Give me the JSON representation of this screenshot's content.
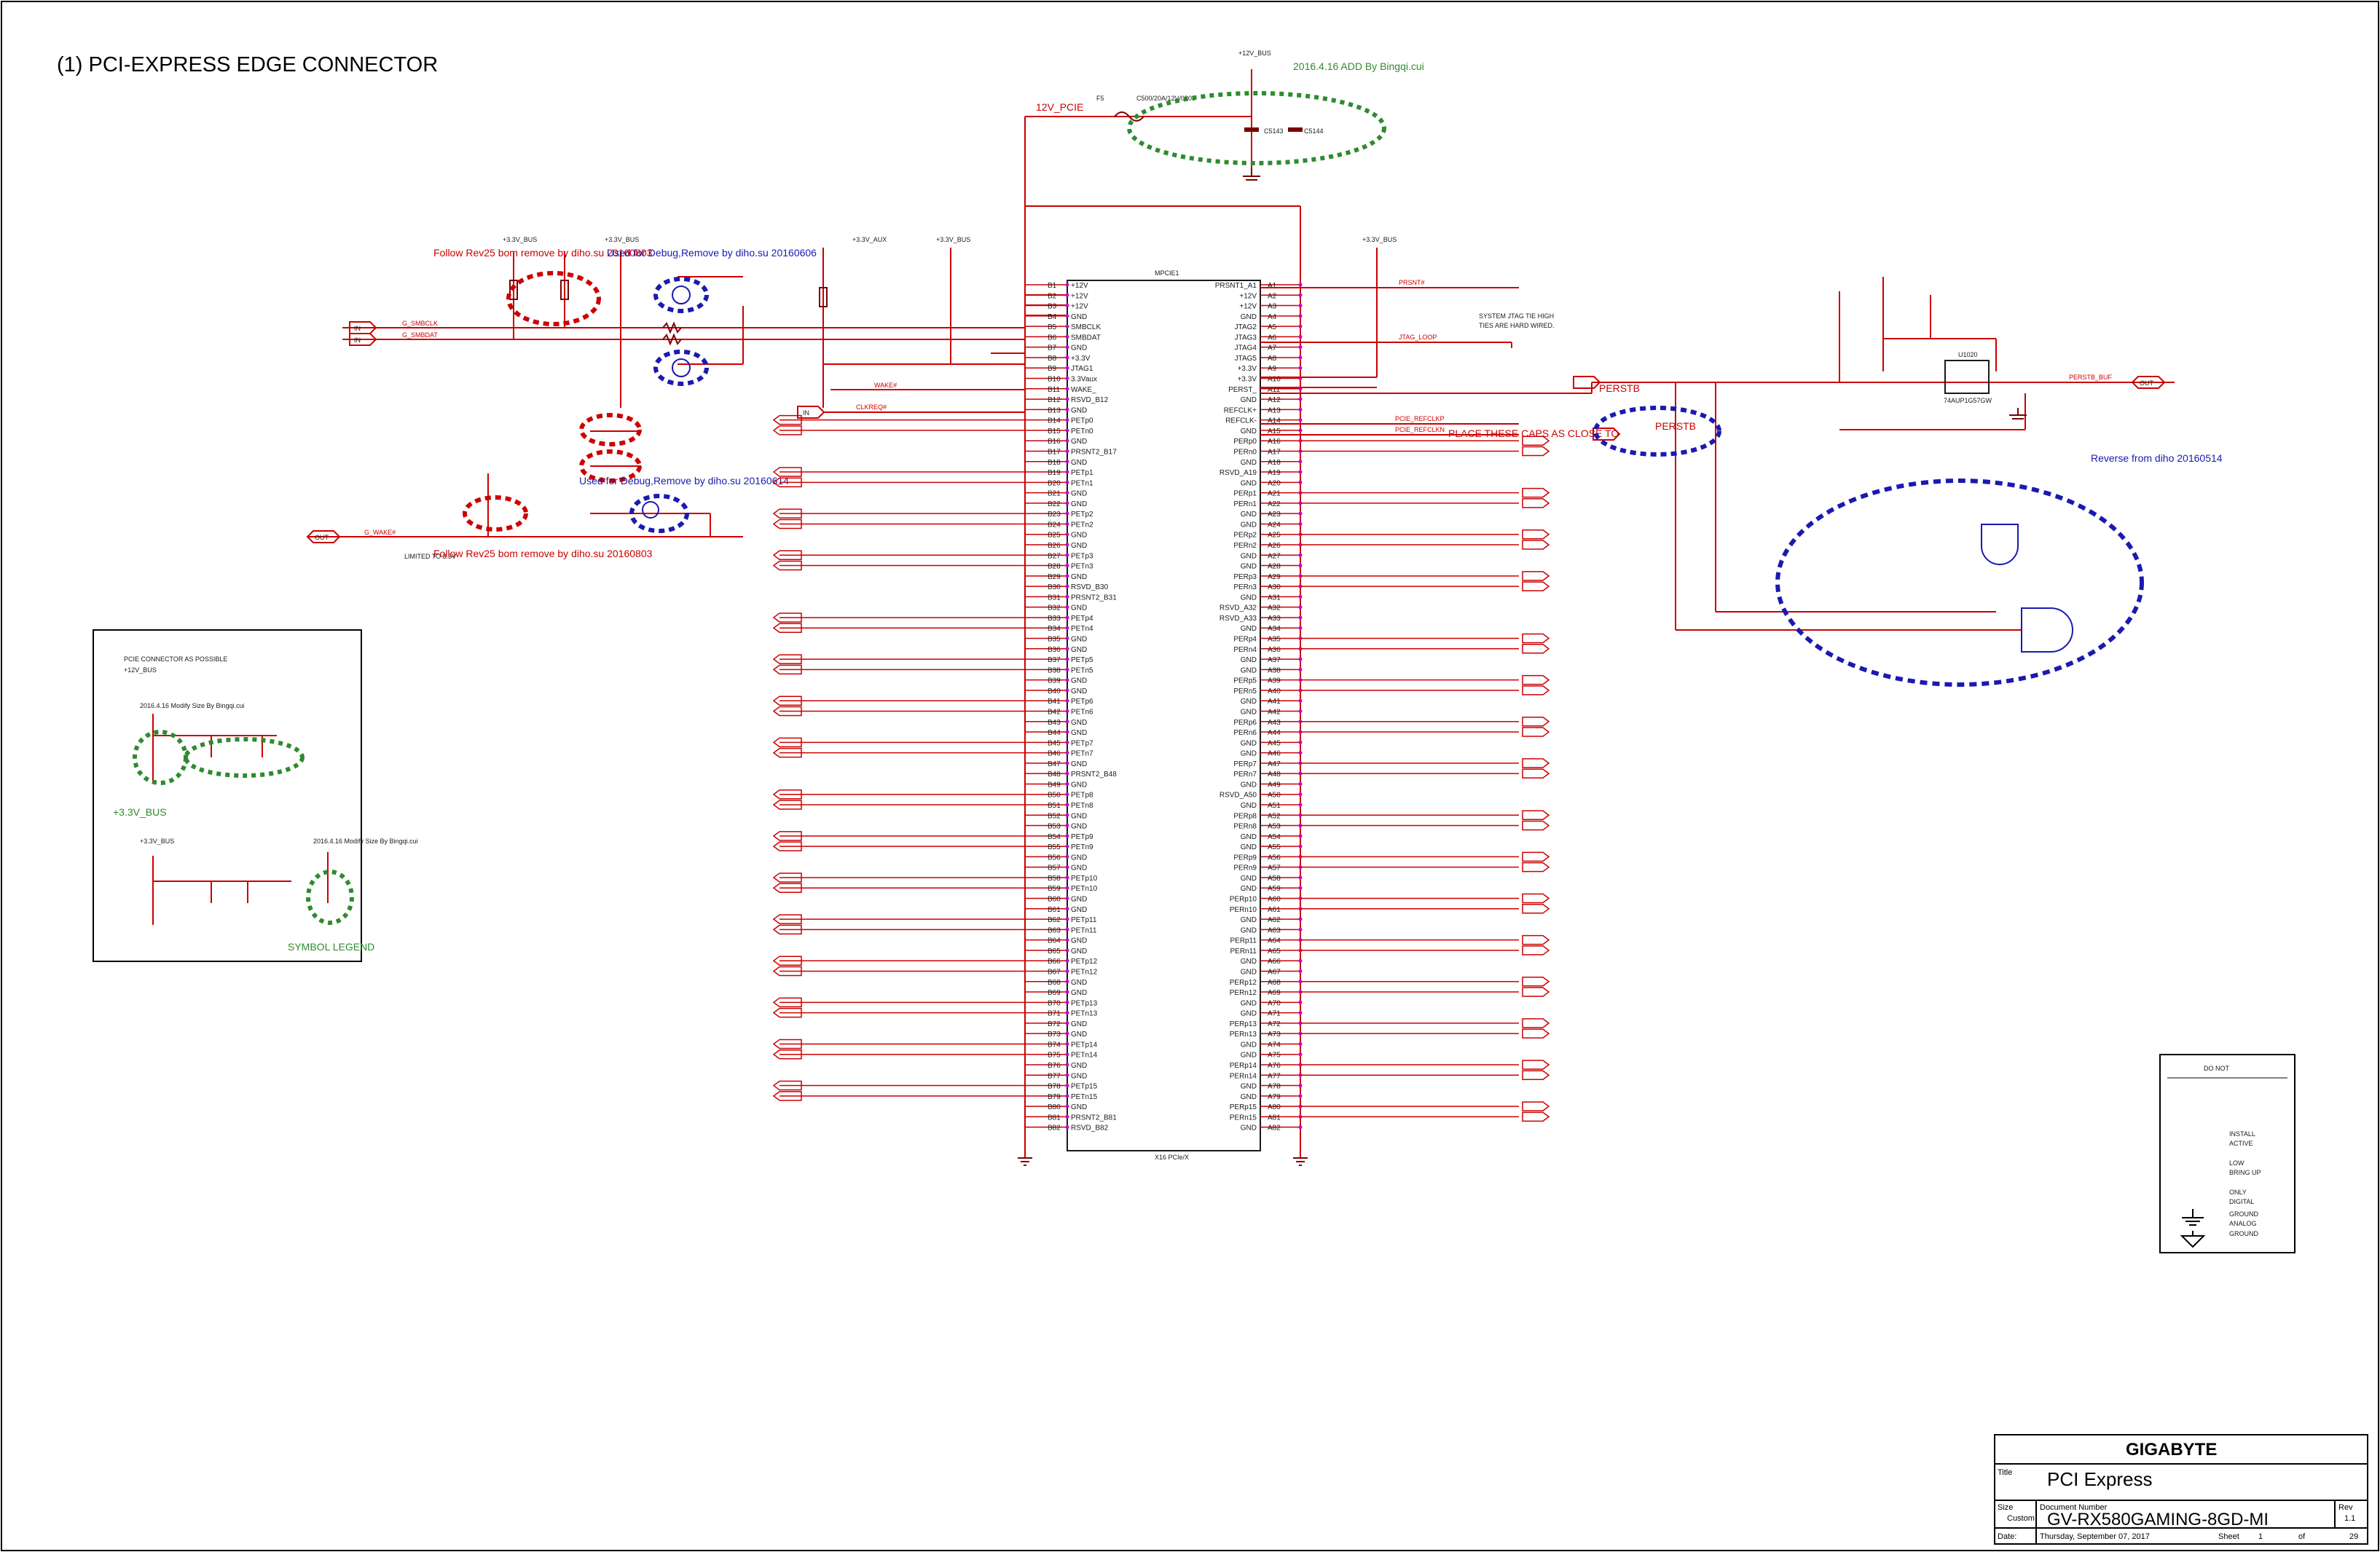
{
  "page": {
    "title": "(1) PCI-EXPRESS EDGE CONNECTOR"
  },
  "connector": {
    "ref": "MPCIE1",
    "bottom_label": "X16 PCIe/X",
    "left_pins": [
      {
        "num": "B1",
        "name": "+12V"
      },
      {
        "num": "B2",
        "name": "+12V"
      },
      {
        "num": "B3",
        "name": "+12V"
      },
      {
        "num": "B4",
        "name": "GND"
      },
      {
        "num": "B5",
        "name": "SMBCLK"
      },
      {
        "num": "B6",
        "name": "SMBDAT"
      },
      {
        "num": "B7",
        "name": "GND"
      },
      {
        "num": "B8",
        "name": "+3.3V"
      },
      {
        "num": "B9",
        "name": "JTAG1"
      },
      {
        "num": "B10",
        "name": "3.3Vaux"
      },
      {
        "num": "B11",
        "name": "WAKE_"
      },
      {
        "num": "B12",
        "name": "RSVD_B12"
      },
      {
        "num": "B13",
        "name": "GND"
      },
      {
        "num": "B14",
        "name": "PETp0"
      },
      {
        "num": "B15",
        "name": "PETn0"
      },
      {
        "num": "B16",
        "name": "GND"
      },
      {
        "num": "B17",
        "name": "PRSNT2_B17"
      },
      {
        "num": "B18",
        "name": "GND"
      },
      {
        "num": "B19",
        "name": "PETp1"
      },
      {
        "num": "B20",
        "name": "PETn1"
      },
      {
        "num": "B21",
        "name": "GND"
      },
      {
        "num": "B22",
        "name": "GND"
      },
      {
        "num": "B23",
        "name": "PETp2"
      },
      {
        "num": "B24",
        "name": "PETn2"
      },
      {
        "num": "B25",
        "name": "GND"
      },
      {
        "num": "B26",
        "name": "GND"
      },
      {
        "num": "B27",
        "name": "PETp3"
      },
      {
        "num": "B28",
        "name": "PETn3"
      },
      {
        "num": "B29",
        "name": "GND"
      },
      {
        "num": "B30",
        "name": "RSVD_B30"
      },
      {
        "num": "B31",
        "name": "PRSNT2_B31"
      },
      {
        "num": "B32",
        "name": "GND"
      },
      {
        "num": "B33",
        "name": "PETp4"
      },
      {
        "num": "B34",
        "name": "PETn4"
      },
      {
        "num": "B35",
        "name": "GND"
      },
      {
        "num": "B36",
        "name": "GND"
      },
      {
        "num": "B37",
        "name": "PETp5"
      },
      {
        "num": "B38",
        "name": "PETn5"
      },
      {
        "num": "B39",
        "name": "GND"
      },
      {
        "num": "B40",
        "name": "GND"
      },
      {
        "num": "B41",
        "name": "PETp6"
      },
      {
        "num": "B42",
        "name": "PETn6"
      },
      {
        "num": "B43",
        "name": "GND"
      },
      {
        "num": "B44",
        "name": "GND"
      },
      {
        "num": "B45",
        "name": "PETp7"
      },
      {
        "num": "B46",
        "name": "PETn7"
      },
      {
        "num": "B47",
        "name": "GND"
      },
      {
        "num": "B48",
        "name": "PRSNT2_B48"
      },
      {
        "num": "B49",
        "name": "GND"
      },
      {
        "num": "B50",
        "name": "PETp8"
      },
      {
        "num": "B51",
        "name": "PETn8"
      },
      {
        "num": "B52",
        "name": "GND"
      },
      {
        "num": "B53",
        "name": "GND"
      },
      {
        "num": "B54",
        "name": "PETp9"
      },
      {
        "num": "B55",
        "name": "PETn9"
      },
      {
        "num": "B56",
        "name": "GND"
      },
      {
        "num": "B57",
        "name": "GND"
      },
      {
        "num": "B58",
        "name": "PETp10"
      },
      {
        "num": "B59",
        "name": "PETn10"
      },
      {
        "num": "B60",
        "name": "GND"
      },
      {
        "num": "B61",
        "name": "GND"
      },
      {
        "num": "B62",
        "name": "PETp11"
      },
      {
        "num": "B63",
        "name": "PETn11"
      },
      {
        "num": "B64",
        "name": "GND"
      },
      {
        "num": "B65",
        "name": "GND"
      },
      {
        "num": "B66",
        "name": "PETp12"
      },
      {
        "num": "B67",
        "name": "PETn12"
      },
      {
        "num": "B68",
        "name": "GND"
      },
      {
        "num": "B69",
        "name": "GND"
      },
      {
        "num": "B70",
        "name": "PETp13"
      },
      {
        "num": "B71",
        "name": "PETn13"
      },
      {
        "num": "B72",
        "name": "GND"
      },
      {
        "num": "B73",
        "name": "GND"
      },
      {
        "num": "B74",
        "name": "PETp14"
      },
      {
        "num": "B75",
        "name": "PETn14"
      },
      {
        "num": "B76",
        "name": "GND"
      },
      {
        "num": "B77",
        "name": "GND"
      },
      {
        "num": "B78",
        "name": "PETp15"
      },
      {
        "num": "B79",
        "name": "PETn15"
      },
      {
        "num": "B80",
        "name": "GND"
      },
      {
        "num": "B81",
        "name": "PRSNT2_B81"
      },
      {
        "num": "B82",
        "name": "RSVD_B82"
      }
    ],
    "right_pins": [
      {
        "num": "A1",
        "name": "PRSNT1_A1"
      },
      {
        "num": "A2",
        "name": "+12V"
      },
      {
        "num": "A3",
        "name": "+12V"
      },
      {
        "num": "A4",
        "name": "GND"
      },
      {
        "num": "A5",
        "name": "JTAG2"
      },
      {
        "num": "A6",
        "name": "JTAG3"
      },
      {
        "num": "A7",
        "name": "JTAG4"
      },
      {
        "num": "A8",
        "name": "JTAG5"
      },
      {
        "num": "A9",
        "name": "+3.3V"
      },
      {
        "num": "A10",
        "name": "+3.3V"
      },
      {
        "num": "A11",
        "name": "PERST_"
      },
      {
        "num": "A12",
        "name": "GND"
      },
      {
        "num": "A13",
        "name": "REFCLK+"
      },
      {
        "num": "A14",
        "name": "REFCLK-"
      },
      {
        "num": "A15",
        "name": "GND"
      },
      {
        "num": "A16",
        "name": "PERp0"
      },
      {
        "num": "A17",
        "name": "PERn0"
      },
      {
        "num": "A18",
        "name": "GND"
      },
      {
        "num": "A19",
        "name": "RSVD_A19"
      },
      {
        "num": "A20",
        "name": "GND"
      },
      {
        "num": "A21",
        "name": "PERp1"
      },
      {
        "num": "A22",
        "name": "PERn1"
      },
      {
        "num": "A23",
        "name": "GND"
      },
      {
        "num": "A24",
        "name": "GND"
      },
      {
        "num": "A25",
        "name": "PERp2"
      },
      {
        "num": "A26",
        "name": "PERn2"
      },
      {
        "num": "A27",
        "name": "GND"
      },
      {
        "num": "A28",
        "name": "GND"
      },
      {
        "num": "A29",
        "name": "PERp3"
      },
      {
        "num": "A30",
        "name": "PERn3"
      },
      {
        "num": "A31",
        "name": "GND"
      },
      {
        "num": "A32",
        "name": "RSVD_A32"
      },
      {
        "num": "A33",
        "name": "RSVD_A33"
      },
      {
        "num": "A34",
        "name": "GND"
      },
      {
        "num": "A35",
        "name": "PERp4"
      },
      {
        "num": "A36",
        "name": "PERn4"
      },
      {
        "num": "A37",
        "name": "GND"
      },
      {
        "num": "A38",
        "name": "GND"
      },
      {
        "num": "A39",
        "name": "PERp5"
      },
      {
        "num": "A40",
        "name": "PERn5"
      },
      {
        "num": "A41",
        "name": "GND"
      },
      {
        "num": "A42",
        "name": "GND"
      },
      {
        "num": "A43",
        "name": "PERp6"
      },
      {
        "num": "A44",
        "name": "PERn6"
      },
      {
        "num": "A45",
        "name": "GND"
      },
      {
        "num": "A46",
        "name": "GND"
      },
      {
        "num": "A47",
        "name": "PERp7"
      },
      {
        "num": "A48",
        "name": "PERn7"
      },
      {
        "num": "A49",
        "name": "GND"
      },
      {
        "num": "A50",
        "name": "RSVD_A50"
      },
      {
        "num": "A51",
        "name": "GND"
      },
      {
        "num": "A52",
        "name": "PERp8"
      },
      {
        "num": "A53",
        "name": "PERn8"
      },
      {
        "num": "A54",
        "name": "GND"
      },
      {
        "num": "A55",
        "name": "GND"
      },
      {
        "num": "A56",
        "name": "PERp9"
      },
      {
        "num": "A57",
        "name": "PERn9"
      },
      {
        "num": "A58",
        "name": "GND"
      },
      {
        "num": "A59",
        "name": "GND"
      },
      {
        "num": "A60",
        "name": "PERp10"
      },
      {
        "num": "A61",
        "name": "PERn10"
      },
      {
        "num": "A62",
        "name": "GND"
      },
      {
        "num": "A63",
        "name": "GND"
      },
      {
        "num": "A64",
        "name": "PERp11"
      },
      {
        "num": "A65",
        "name": "PERn11"
      },
      {
        "num": "A66",
        "name": "GND"
      },
      {
        "num": "A67",
        "name": "GND"
      },
      {
        "num": "A68",
        "name": "PERp12"
      },
      {
        "num": "A69",
        "name": "PERn12"
      },
      {
        "num": "A70",
        "name": "GND"
      },
      {
        "num": "A71",
        "name": "GND"
      },
      {
        "num": "A72",
        "name": "PERp13"
      },
      {
        "num": "A73",
        "name": "PERn13"
      },
      {
        "num": "A74",
        "name": "GND"
      },
      {
        "num": "A75",
        "name": "GND"
      },
      {
        "num": "A76",
        "name": "PERp14"
      },
      {
        "num": "A77",
        "name": "PERn14"
      },
      {
        "num": "A78",
        "name": "GND"
      },
      {
        "num": "A79",
        "name": "GND"
      },
      {
        "num": "A80",
        "name": "PERp15"
      },
      {
        "num": "A81",
        "name": "PERn15"
      },
      {
        "num": "A82",
        "name": "GND"
      }
    ]
  },
  "texts": [
    {
      "id": "rail-12v-top",
      "text": "+12V_BUS",
      "cls": "tiny"
    },
    {
      "id": "note-add-bingqi",
      "text": "2016.4.16 ADD By Bingqi.cui",
      "cls": "green note"
    },
    {
      "id": "net-12v-pcie",
      "text": "12V_PCIE",
      "cls": "red note"
    },
    {
      "id": "fuse-ref",
      "text": "F5",
      "cls": "tiny"
    },
    {
      "id": "fuse-val",
      "text": "C500/20A/12V/0805",
      "cls": "tiny"
    },
    {
      "id": "cap-c5143",
      "text": "C5143",
      "cls": "tiny"
    },
    {
      "id": "cap-c5144",
      "text": "C5144",
      "cls": "tiny"
    },
    {
      "id": "note-follow-1",
      "text": "Follow Rev25 bom remove by diho.su 20160803",
      "cls": "red note"
    },
    {
      "id": "note-debug-1",
      "text": "Used for Debug,Remove by diho.su 20160606",
      "cls": "blue note"
    },
    {
      "id": "net-smbclk",
      "text": "G_SMBCLK",
      "cls": "red tiny"
    },
    {
      "id": "net-smbdat",
      "text": "G_SMBDAT",
      "cls": "red tiny"
    },
    {
      "id": "port-in-1",
      "text": "IN",
      "cls": "tiny"
    },
    {
      "id": "port-in-2",
      "text": "IN",
      "cls": "tiny"
    },
    {
      "id": "port-in-cls",
      "text": "IN",
      "cls": "tiny"
    },
    {
      "id": "net-clkreq",
      "text": "CLKREQ#",
      "cls": "red tiny"
    },
    {
      "id": "note-debug-2",
      "text": "Used for Debug,Remove by diho.su 20160614",
      "cls": "blue note"
    },
    {
      "id": "note-follow-2",
      "text": "Follow Rev25 bom remove by diho.su 20160803",
      "cls": "red note"
    },
    {
      "id": "net-gwake",
      "text": "G_WAKE#",
      "cls": "red tiny"
    },
    {
      "id": "port-out-wake",
      "text": "OUT",
      "cls": "tiny"
    },
    {
      "id": "note-limited",
      "text": "LIMITED TO 3.3V",
      "cls": "tiny"
    },
    {
      "id": "rail-33v-aux",
      "text": "+3.3V_AUX",
      "cls": "tiny"
    },
    {
      "id": "rail-33v-bus-1",
      "text": "+3.3V_BUS",
      "cls": "tiny"
    },
    {
      "id": "rail-33v-bus-2",
      "text": "+3.3V_BUS",
      "cls": "tiny"
    },
    {
      "id": "rail-33v-bus-3",
      "text": "+3.3V_BUS",
      "cls": "tiny"
    },
    {
      "id": "rail-33v-bus-4",
      "text": "+3.3V_BUS",
      "cls": "tiny"
    },
    {
      "id": "net-wakeb",
      "text": "WAKE#",
      "cls": "red tiny"
    },
    {
      "id": "net-prsnt",
      "text": "PRSNT#",
      "cls": "red tiny"
    },
    {
      "id": "net-jtag",
      "text": "JTAG_LOOP",
      "cls": "red tiny"
    },
    {
      "id": "note-system-jtag",
      "text": "SYSTEM JTAG TIE HIGH",
      "cls": "tiny"
    },
    {
      "id": "note-ties",
      "text": "TIES ARE HARD WIRED.",
      "cls": "tiny"
    },
    {
      "id": "net-refclkp",
      "text": "PCIE_REFCLKP",
      "cls": "red tiny"
    },
    {
      "id": "net-refclkn",
      "text": "PCIE_REFCLKN",
      "cls": "red tiny"
    },
    {
      "id": "net-perstb",
      "text": "PERSTB",
      "cls": "red note"
    },
    {
      "id": "net-perstb2",
      "text": "PERSTB",
      "cls": "red note"
    },
    {
      "id": "note-reverse",
      "text": "Reverse from diho 20160514",
      "cls": "blue note"
    },
    {
      "id": "ic-u1020",
      "text": "U1020",
      "cls": "tiny"
    },
    {
      "id": "ic-logic",
      "text": "74AUP1G57GW",
      "cls": "tiny"
    },
    {
      "id": "net-perstb-buf",
      "text": "PERSTB_BUF",
      "cls": "red tiny"
    },
    {
      "id": "port-out-perst",
      "text": "OUT",
      "cls": "tiny"
    },
    {
      "id": "net-num-29",
      "text": "29",
      "cls": "red note"
    },
    {
      "id": "box-note-1",
      "text": "PLACE THESE CAPS AS CLOSE TO",
      "cls": "tiny"
    },
    {
      "id": "box-note-2",
      "text": "PCIE CONNECTOR AS POSSIBLE",
      "cls": "tiny"
    },
    {
      "id": "box-12v",
      "text": "+12V_BUS",
      "cls": "tiny"
    },
    {
      "id": "note-modify-1",
      "text": "2016.4.16 Modify Size By Bingqi.cui",
      "cls": "green note"
    },
    {
      "id": "box-33v",
      "text": "+3.3V_BUS",
      "cls": "tiny"
    },
    {
      "id": "box-33v-2",
      "text": "+3.3V_BUS",
      "cls": "tiny"
    },
    {
      "id": "note-modify-2",
      "text": "2016.4.16 Modify Size By Bingqi.cui",
      "cls": "green note"
    },
    {
      "id": "legend-title",
      "text": "SYMBOL LEGEND",
      "cls": "tiny"
    },
    {
      "id": "legend-1a",
      "text": "DO NOT",
      "cls": "tiny"
    },
    {
      "id": "legend-1b",
      "text": "INSTALL",
      "cls": "tiny"
    },
    {
      "id": "legend-2a",
      "text": "ACTIVE",
      "cls": "tiny"
    },
    {
      "id": "legend-2b",
      "text": "LOW",
      "cls": "tiny"
    },
    {
      "id": "legend-3a",
      "text": "BRING UP",
      "cls": "tiny"
    },
    {
      "id": "legend-3b",
      "text": "ONLY",
      "cls": "tiny"
    },
    {
      "id": "legend-4a",
      "text": "DIGITAL",
      "cls": "tiny"
    },
    {
      "id": "legend-4b",
      "text": "GROUND",
      "cls": "tiny"
    },
    {
      "id": "legend-5a",
      "text": "ANALOG",
      "cls": "tiny"
    },
    {
      "id": "legend-5b",
      "text": "GROUND",
      "cls": "tiny"
    }
  ],
  "title_block": {
    "company": "GIGABYTE",
    "title_label": "Title",
    "title": "PCI Express",
    "size_label": "Size",
    "size": "Custom",
    "docnum_label": "Document Number",
    "docnum": "GV-RX580GAMING-8GD-MI",
    "rev_label": "Rev",
    "rev": "1.1",
    "date_label": "Date:",
    "date": "Thursday, September 07, 2017",
    "sheet_label": "Sheet",
    "sheet": "1",
    "of_label": "of",
    "total": "29"
  },
  "colors": {
    "wire": "#cc0000",
    "component": "#7a0000",
    "junction": "#cc00cc",
    "annotation_red": "#cc0000",
    "annotation_blue": "#1a1ab0",
    "annotation_green": "#2e8b2e"
  }
}
